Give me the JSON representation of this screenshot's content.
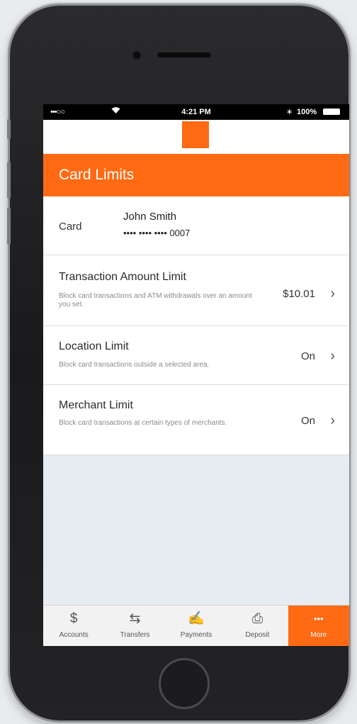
{
  "status_bar": {
    "signal": "•••○○",
    "time": "4:21 PM",
    "bluetooth": "∗",
    "battery": "100%"
  },
  "header": {
    "title": "Card Limits",
    "brand_color": "#ff6a13"
  },
  "card": {
    "label": "Card",
    "holder": "John Smith",
    "number": "•••• •••• •••• 0007"
  },
  "limits": [
    {
      "title": "Transaction Amount Limit",
      "description": "Block card transactions and ATM withdrawals over an amount you set.",
      "value": "$10.01"
    },
    {
      "title": "Location Limit",
      "description": "Block card transactions outside a selected area.",
      "value": "On"
    },
    {
      "title": "Merchant Limit",
      "description": "Block card transactions at certain types of merchants.",
      "value": "On"
    }
  ],
  "tabs": [
    {
      "label": "Accounts",
      "icon": "dollar-icon",
      "glyph": "$"
    },
    {
      "label": "Transfers",
      "icon": "transfer-icon",
      "glyph": "⇆"
    },
    {
      "label": "Payments",
      "icon": "payment-icon",
      "glyph": "✍"
    },
    {
      "label": "Deposit",
      "icon": "deposit-icon",
      "glyph": "⎙"
    },
    {
      "label": "More",
      "icon": "more-icon",
      "glyph": "•••"
    }
  ],
  "chevron": "›"
}
